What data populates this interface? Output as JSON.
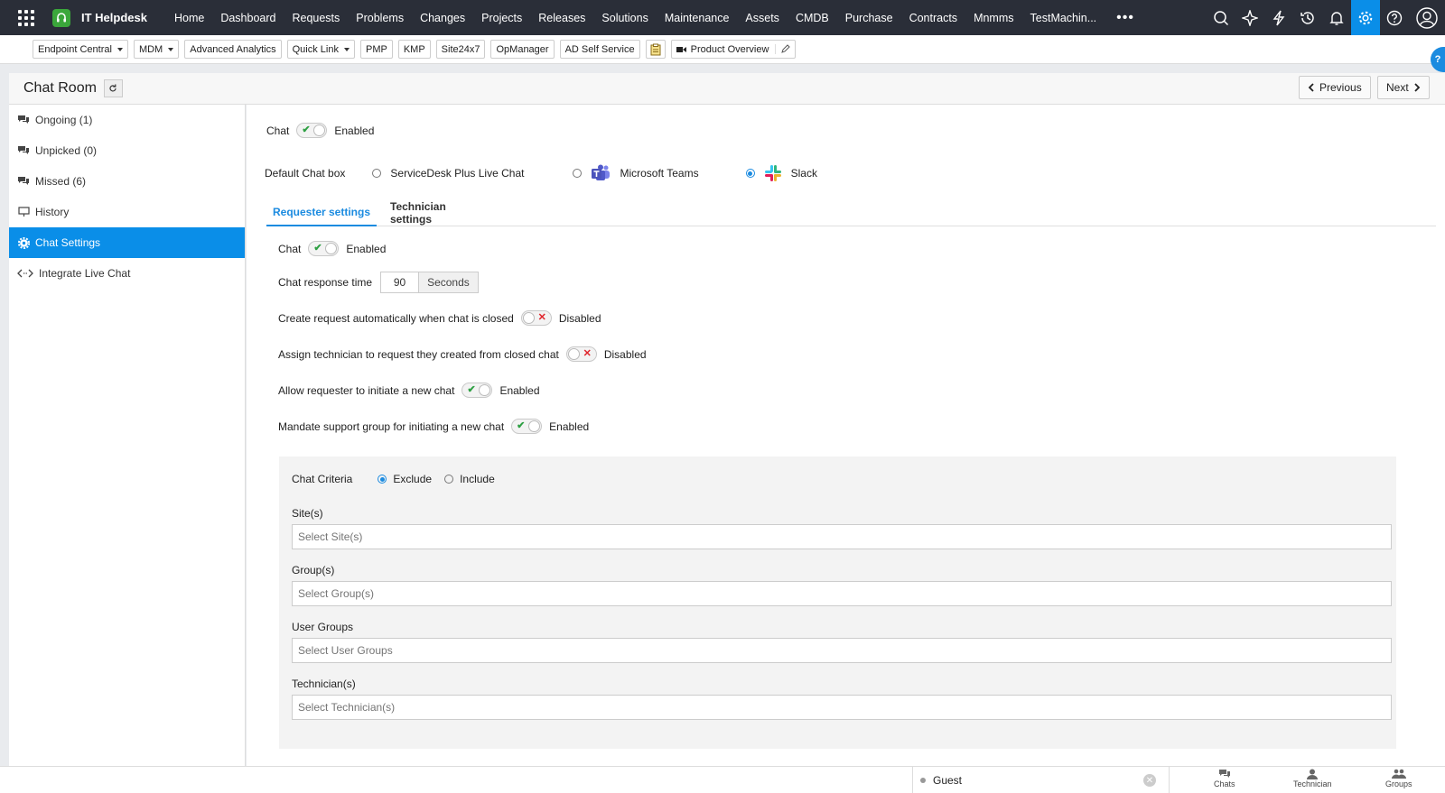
{
  "nav": {
    "app_name": "IT Helpdesk",
    "menu": [
      "Home",
      "Dashboard",
      "Requests",
      "Problems",
      "Changes",
      "Projects",
      "Releases",
      "Solutions",
      "Maintenance",
      "Assets",
      "CMDB",
      "Purchase",
      "Contracts",
      "Mnmms",
      "TestMachin..."
    ],
    "more": "•••",
    "icons": [
      "search-icon",
      "sparkle-icon",
      "lightning-icon",
      "history-icon",
      "bell-icon",
      "gear-icon",
      "help-icon",
      "user-avatar-icon"
    ]
  },
  "toolbar": {
    "items": [
      "Endpoint Central",
      "MDM",
      "Advanced Analytics",
      "Quick Link",
      "PMP",
      "KMP",
      "Site24x7",
      "OpManager",
      "AD Self Service"
    ],
    "product_overview": "Product Overview"
  },
  "header": {
    "title": "Chat Room",
    "previous": "Previous",
    "next": "Next"
  },
  "sidebar": {
    "items": [
      {
        "label": "Ongoing (1)",
        "icon": "chat-bubbles-icon"
      },
      {
        "label": "Unpicked (0)",
        "icon": "chat-bubbles-icon"
      },
      {
        "label": "Missed (6)",
        "icon": "chat-bubbles-icon"
      },
      {
        "label": "History",
        "icon": "monitor-icon"
      },
      {
        "label": "Chat Settings",
        "icon": "gear-icon"
      },
      {
        "label": "Integrate Live Chat",
        "icon": "code-icon"
      }
    ]
  },
  "settings": {
    "chat_label": "Chat",
    "chat_status": "Enabled",
    "default_chat_box_label": "Default Chat box",
    "chat_box_options": [
      "ServiceDesk Plus Live Chat",
      "Microsoft Teams",
      "Slack"
    ],
    "selected_chat_box": "Slack",
    "tabs": [
      "Requester settings",
      "Technician settings"
    ],
    "requester": {
      "chat_label": "Chat",
      "chat_status": "Enabled",
      "response_time_label": "Chat response time",
      "response_time_value": "90",
      "response_time_unit": "Seconds",
      "auto_request_label": "Create request automatically when chat is closed",
      "auto_request_status": "Disabled",
      "assign_tech_label": "Assign technician to request they created from closed chat",
      "assign_tech_status": "Disabled",
      "allow_new_chat_label": "Allow requester to initiate a new chat",
      "allow_new_chat_status": "Enabled",
      "mandate_group_label": "Mandate support group for initiating a new chat",
      "mandate_group_status": "Enabled"
    },
    "criteria": {
      "label": "Chat Criteria",
      "exclude": "Exclude",
      "include": "Include",
      "selected": "Exclude",
      "fields": [
        {
          "label": "Site(s)",
          "placeholder": "Select Site(s)"
        },
        {
          "label": "Group(s)",
          "placeholder": "Select Group(s)"
        },
        {
          "label": "User Groups",
          "placeholder": "Select User Groups"
        },
        {
          "label": "Technician(s)",
          "placeholder": "Select Technician(s)"
        }
      ]
    }
  },
  "bottom": {
    "guest": "Guest",
    "chats": "Chats",
    "technician": "Technician",
    "groups": "Groups"
  },
  "colors": {
    "accent": "#0a8ee8",
    "topbar": "#2a2e38",
    "enabled": "#2ea043",
    "disabled": "#e0242b"
  }
}
